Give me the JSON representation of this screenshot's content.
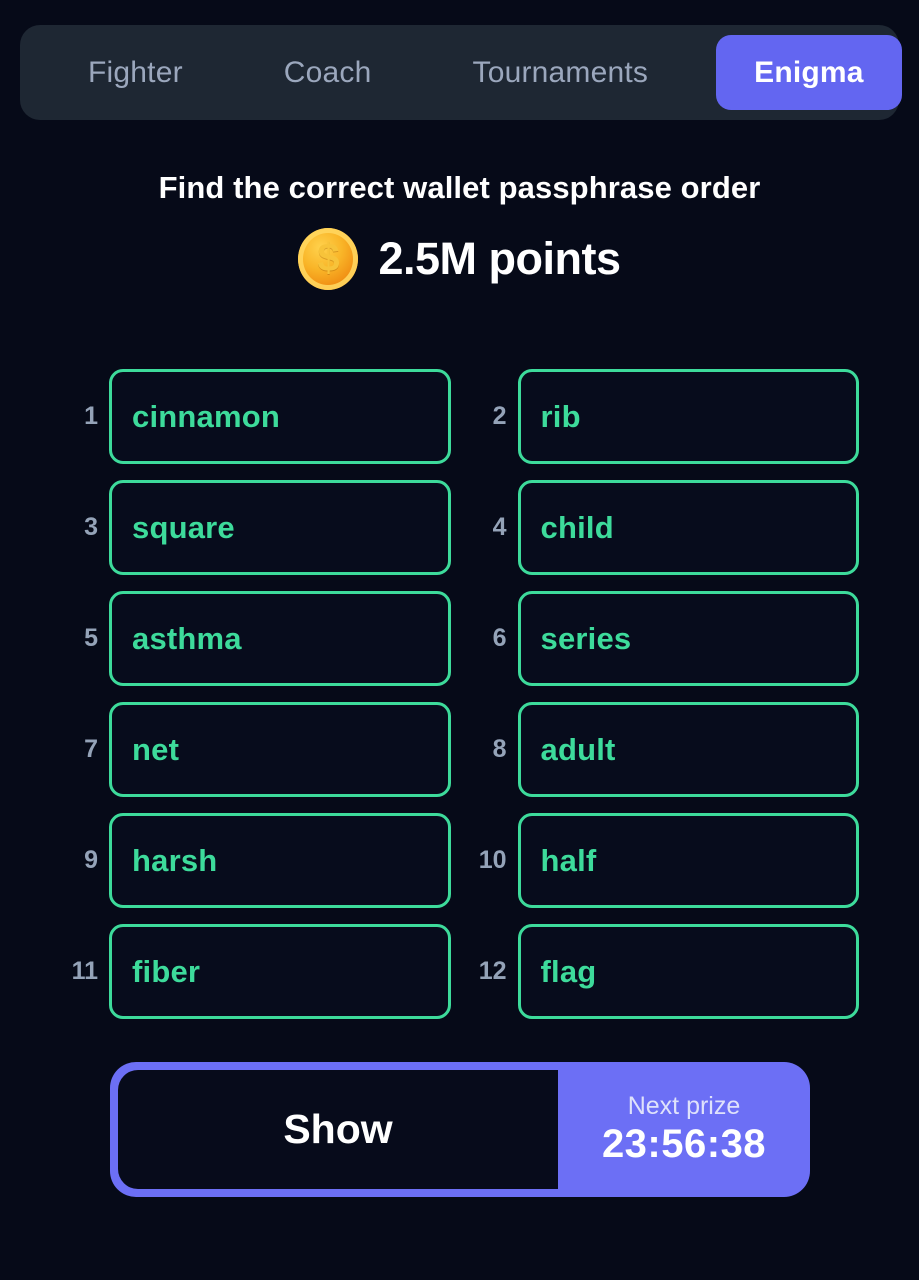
{
  "colors": {
    "background": "#060a18",
    "tabbar_bg": "#1e2733",
    "accent_purple": "#6366f1",
    "bottom_purple": "#6c6ff5",
    "word_green": "#3ddb9b",
    "number_gray": "#94a3b8",
    "inactive_tab": "#9ba7bd",
    "coin_gold": "#f9b528"
  },
  "tabs": [
    {
      "label": "Fighter",
      "active": false,
      "class": "t-fighter"
    },
    {
      "label": "Coach",
      "active": false,
      "class": "t-coach"
    },
    {
      "label": "Tournaments",
      "active": false,
      "class": "t-tourn"
    },
    {
      "label": "Enigma",
      "active": true,
      "class": "t-enigma"
    }
  ],
  "header": {
    "title": "Find the correct wallet passphrase order"
  },
  "points": {
    "icon": "gold-coin-dollar-icon",
    "dollar_glyph": "$",
    "amount": "2.5M points"
  },
  "grid": {
    "cells": [
      {
        "num": "1",
        "word": "cinnamon"
      },
      {
        "num": "2",
        "word": "rib"
      },
      {
        "num": "3",
        "word": "square"
      },
      {
        "num": "4",
        "word": "child"
      },
      {
        "num": "5",
        "word": "asthma"
      },
      {
        "num": "6",
        "word": "series"
      },
      {
        "num": "7",
        "word": "net"
      },
      {
        "num": "8",
        "word": "adult"
      },
      {
        "num": "9",
        "word": "harsh"
      },
      {
        "num": "10",
        "word": "half"
      },
      {
        "num": "11",
        "word": "fiber"
      },
      {
        "num": "12",
        "word": "flag"
      }
    ]
  },
  "bottom": {
    "show_label": "Show",
    "prize_label": "Next prize",
    "prize_time": "23:56:38"
  }
}
